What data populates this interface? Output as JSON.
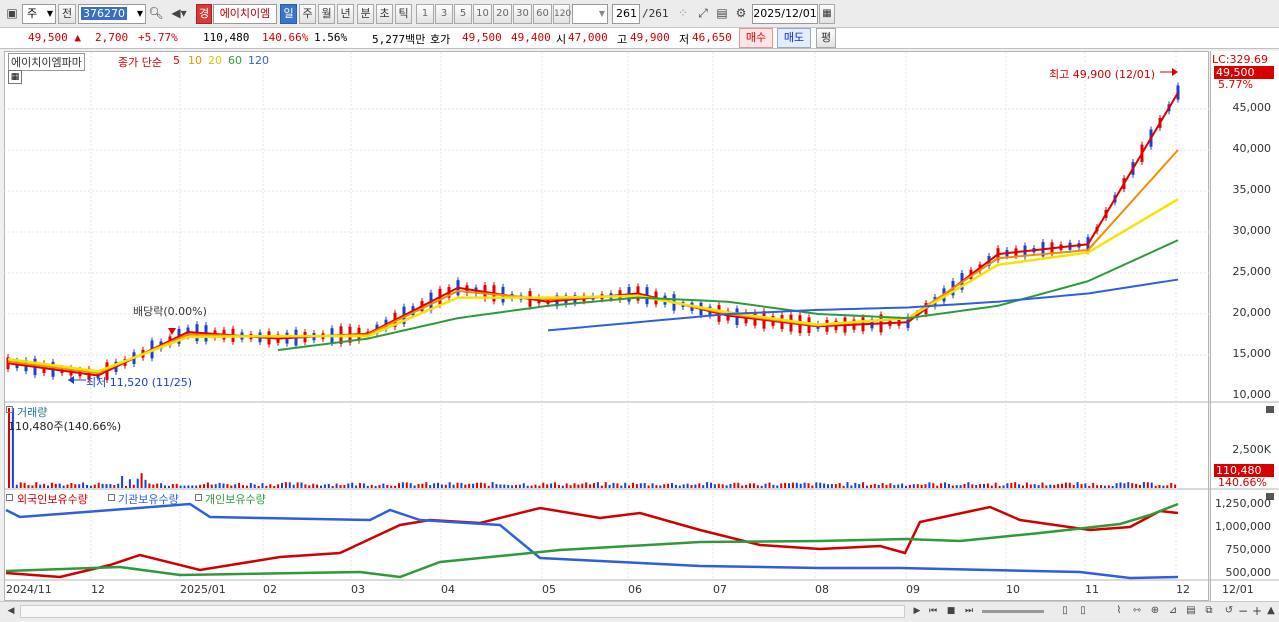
{
  "toolbar": {
    "market": "주",
    "prev_label": "전",
    "code": "376270",
    "warning_badge": "경",
    "stock_name": "에이치이엠",
    "periods": [
      "일",
      "주",
      "월",
      "년",
      "분",
      "초",
      "틱"
    ],
    "active_period": "일",
    "intervals": [
      "1",
      "3",
      "5",
      "10",
      "20",
      "30",
      "60",
      "120"
    ],
    "count": "261",
    "count_total": "/261",
    "date": "2025/12/01"
  },
  "quote": {
    "price": "49,500",
    "up_arrow": "▲",
    "change": "2,700",
    "change_pct": "+5.77%",
    "volume": "110,480",
    "volume_ratio": "140.66%",
    "turnover": "1.56%",
    "amount": "5,277백만",
    "hoga_label": "호가",
    "ask": "49,500",
    "bid": "49,400",
    "open_label": "시",
    "open": "47,000",
    "high_label": "고",
    "high": "49,900",
    "low_label": "저",
    "low": "46,650",
    "buy_label": "매수",
    "sell_label": "매도",
    "flat_label": "평"
  },
  "price_pane": {
    "name_label": "에이치이엠파마",
    "ma_label": "종가 단순",
    "ma_periods": [
      "5",
      "10",
      "20",
      "60",
      "120"
    ],
    "lc": "LC:329.69",
    "current_tag": "49,500",
    "current_pct": "5.77%",
    "high_note": "최고 49,900 (12/01)",
    "low_note": "최저 11,520 (11/25)",
    "dividend_note": "배당락(0.00%)",
    "yticks": [
      "45,000",
      "40,000",
      "35,000",
      "30,000",
      "25,000",
      "20,000",
      "15,000",
      "10,000"
    ]
  },
  "volume_pane": {
    "label": "거래량",
    "value": "110,480주(140.66%)",
    "ytick": "2,500K",
    "tag_value": "110,480",
    "tag_pct": "140.66%"
  },
  "holding_pane": {
    "legend": [
      "외국인보유수량",
      "기관보유수량",
      "개인보유수량"
    ],
    "yticks": [
      "1,250,000",
      "1,000,000",
      "750,000",
      "500,000"
    ]
  },
  "xaxis": [
    "2024/11",
    "12",
    "2025/01",
    "02",
    "03",
    "04",
    "05",
    "06",
    "07",
    "08",
    "09",
    "10",
    "11",
    "12",
    "12/01"
  ],
  "colors": {
    "ma5": "#e00000",
    "ma10": "#f08c00",
    "ma20": "#f5e400",
    "ma60": "#2e9a3c",
    "ma120": "#2f5fdd",
    "up": "#e00000",
    "down": "#1a3fd6"
  },
  "chart_data": {
    "type": "line",
    "x": [
      "2024-11",
      "2024-12",
      "2025-01",
      "2025-02",
      "2025-03",
      "2025-04",
      "2025-05",
      "2025-06",
      "2025-07",
      "2025-08",
      "2025-09",
      "2025-10",
      "2025-11",
      "2025-12"
    ],
    "series": [
      {
        "name": "5",
        "values": [
          14000,
          12500,
          17800,
          17000,
          17600,
          23200,
          21500,
          22500,
          19800,
          18500,
          19000,
          27300,
          28500,
          47000
        ]
      },
      {
        "name": "10",
        "values": [
          14200,
          12800,
          17500,
          17200,
          17500,
          22800,
          21800,
          22300,
          20000,
          18600,
          19500,
          26800,
          27800,
          40000
        ]
      },
      {
        "name": "20",
        "values": [
          14500,
          13000,
          17200,
          17300,
          17300,
          22000,
          22000,
          22200,
          20200,
          18700,
          19500,
          26000,
          27500,
          34000
        ]
      },
      {
        "name": "60",
        "values": [
          null,
          null,
          null,
          15600,
          17000,
          19500,
          21000,
          22000,
          21500,
          20000,
          19500,
          21000,
          24000,
          29000
        ]
      },
      {
        "name": "120",
        "values": [
          null,
          null,
          null,
          null,
          null,
          null,
          18000,
          19000,
          20000,
          20500,
          20800,
          21500,
          22500,
          24200
        ]
      }
    ],
    "ylim": [
      10000,
      50000
    ]
  }
}
